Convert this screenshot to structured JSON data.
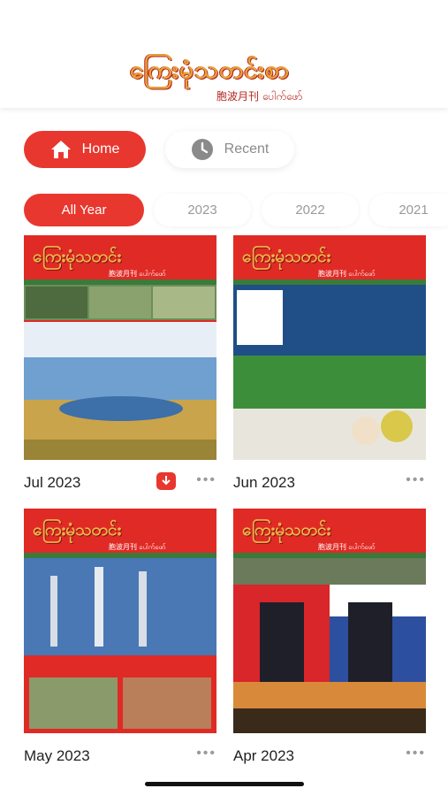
{
  "header": {
    "logo_text": "ကြေးမုံသတင်းစာ",
    "logo_subtitle": "胞波月刊 ပေါက်ဖော်"
  },
  "nav": {
    "home_label": "Home",
    "recent_label": "Recent",
    "home_icon": "house-icon",
    "recent_icon": "clock-icon"
  },
  "years": [
    "All Year",
    "2023",
    "2022",
    "2021"
  ],
  "magazines": [
    {
      "label": "Jul 2023",
      "cover_title": "ကြေးမုံသတင်း",
      "cover_subtitle": "胞波月刊 ပေါက်ဖော်",
      "downloaded": true
    },
    {
      "label": "Jun 2023",
      "cover_title": "ကြေးမုံသတင်း",
      "cover_subtitle": "胞波月刊 ပေါက်ဖော်",
      "downloaded": false
    },
    {
      "label": "May 2023",
      "cover_title": "ကြေးမုံသတင်း",
      "cover_subtitle": "胞波月刊 ပေါက်ဖော်",
      "downloaded": false
    },
    {
      "label": "Apr 2023",
      "cover_title": "ကြေးမုံသတင်း",
      "cover_subtitle": "胞波月刊 ပေါက်ဖော်",
      "downloaded": false
    }
  ],
  "colors": {
    "accent": "#e8372e",
    "cover_red": "#e02a25",
    "logo_gold": "#e8a23a"
  }
}
